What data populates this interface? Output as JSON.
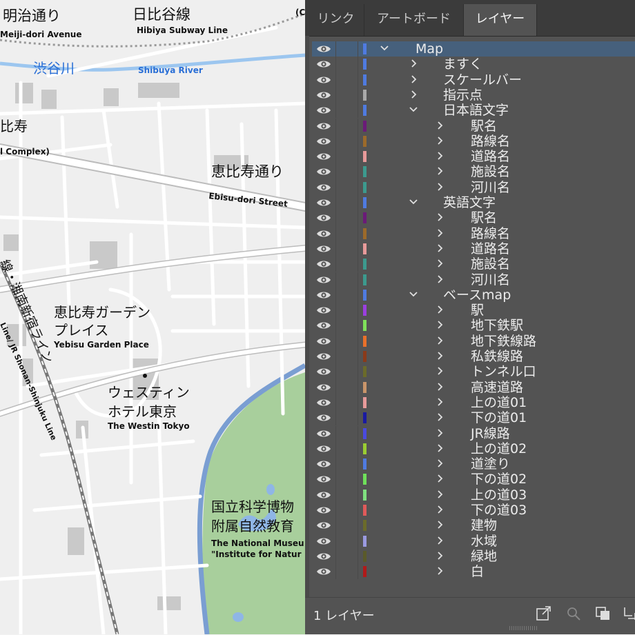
{
  "map": {
    "labels": {
      "meiji_jp": "明治通り",
      "meiji_en": "Meiji-dori Avenue",
      "hibiya_jp": "日比谷線",
      "hibiya_en": "Hibiya Subway Line",
      "shibuya_river_jp": "渋谷川",
      "shibuya_river_en": "Shibuya River",
      "ebisu_partial": "比寿",
      "complex_partial": "l Complex)",
      "ebisu_dori_jp": "恵比寿通り",
      "ebisu_dori_en": "Ebisu-dori Street",
      "garden_jp_1": "恵比寿ガーデン",
      "garden_jp_2": "プレイス",
      "garden_en": "Yebisu Garden Place",
      "westin_jp_1": "ウェスティン",
      "westin_jp_2": "ホテル東京",
      "westin_en": "The Westin Tokyo",
      "shonan_jp": "線・湘南新宿ライン",
      "shonan_en": "Line/ JR Shonan-Shinjuku Line",
      "museum_jp_1": "国立科学博物",
      "museum_jp_2": "附属自然教育",
      "museum_en_1": "The National Museu",
      "museum_en_2": "\"Institute for Natur",
      "top_right_partial": "(C"
    }
  },
  "panel": {
    "tabs": [
      {
        "label": "リンク",
        "active": false
      },
      {
        "label": "アートボード",
        "active": false
      },
      {
        "label": "レイヤー",
        "active": true
      }
    ],
    "layers": [
      {
        "name": "Map",
        "depth": 0,
        "expanded": true,
        "color": "#4f7be0",
        "selected": true
      },
      {
        "name": "ますく",
        "depth": 1,
        "expanded": false,
        "color": "#4f7be0"
      },
      {
        "name": "スケールバー",
        "depth": 1,
        "expanded": false,
        "color": "#4f7be0"
      },
      {
        "name": "指示点",
        "depth": 1,
        "expanded": false,
        "color": "#a9a9a9"
      },
      {
        "name": "日本語文字",
        "depth": 1,
        "expanded": true,
        "color": "#4f7be0"
      },
      {
        "name": "駅名",
        "depth": 2,
        "expanded": false,
        "color": "#6a1b78"
      },
      {
        "name": "路線名",
        "depth": 2,
        "expanded": false,
        "color": "#9c6a2a"
      },
      {
        "name": "道路名",
        "depth": 2,
        "expanded": false,
        "color": "#e79a9a"
      },
      {
        "name": "施設名",
        "depth": 2,
        "expanded": false,
        "color": "#3c9a8e"
      },
      {
        "name": "河川名",
        "depth": 2,
        "expanded": false,
        "color": "#3c9a8e"
      },
      {
        "name": "英語文字",
        "depth": 1,
        "expanded": true,
        "color": "#4f7be0"
      },
      {
        "name": "駅名",
        "depth": 2,
        "expanded": false,
        "color": "#6a1b78"
      },
      {
        "name": "路線名",
        "depth": 2,
        "expanded": false,
        "color": "#9c6a2a"
      },
      {
        "name": "道路名",
        "depth": 2,
        "expanded": false,
        "color": "#e79a9a"
      },
      {
        "name": "施設名",
        "depth": 2,
        "expanded": false,
        "color": "#3c9a8e"
      },
      {
        "name": "河川名",
        "depth": 2,
        "expanded": false,
        "color": "#3c9a8e"
      },
      {
        "name": "ベースmap",
        "depth": 1,
        "expanded": true,
        "color": "#4f7be0"
      },
      {
        "name": "駅",
        "depth": 2,
        "expanded": false,
        "color": "#9b3fe0"
      },
      {
        "name": "地下鉄駅",
        "depth": 2,
        "expanded": false,
        "color": "#7fe05a"
      },
      {
        "name": "地下鉄線路",
        "depth": 2,
        "expanded": false,
        "color": "#e8702a"
      },
      {
        "name": "私鉄線路",
        "depth": 2,
        "expanded": false,
        "color": "#8a3a1a"
      },
      {
        "name": "トンネル口",
        "depth": 2,
        "expanded": false,
        "color": "#6b6b2a"
      },
      {
        "name": "高速道路",
        "depth": 2,
        "expanded": false,
        "color": "#c9956a"
      },
      {
        "name": "上の道01",
        "depth": 2,
        "expanded": false,
        "color": "#e79a9a"
      },
      {
        "name": "下の道01",
        "depth": 2,
        "expanded": false,
        "color": "#1a1aa0"
      },
      {
        "name": "JR線路",
        "depth": 2,
        "expanded": false,
        "color": "#4a4ae0"
      },
      {
        "name": "上の道02",
        "depth": 2,
        "expanded": false,
        "color": "#9acd32"
      },
      {
        "name": "道塗り",
        "depth": 2,
        "expanded": false,
        "color": "#4f7be0"
      },
      {
        "name": "下の道02",
        "depth": 2,
        "expanded": false,
        "color": "#6fe05a"
      },
      {
        "name": "上の道03",
        "depth": 2,
        "expanded": false,
        "color": "#7fe07f"
      },
      {
        "name": "下の道03",
        "depth": 2,
        "expanded": false,
        "color": "#e05a5a"
      },
      {
        "name": "建物",
        "depth": 2,
        "expanded": false,
        "color": "#6b6b2a"
      },
      {
        "name": "水域",
        "depth": 2,
        "expanded": false,
        "color": "#9a9ae0"
      },
      {
        "name": "緑地",
        "depth": 2,
        "expanded": false,
        "color": "#5a5a2a"
      },
      {
        "name": "白",
        "depth": 2,
        "expanded": false,
        "color": "#b01a1a"
      }
    ],
    "footer": {
      "count_label": "1 レイヤー",
      "icons": [
        "export-icon",
        "locate-object-icon",
        "collect-export-icon",
        "make-clip-mask-icon"
      ]
    }
  }
}
